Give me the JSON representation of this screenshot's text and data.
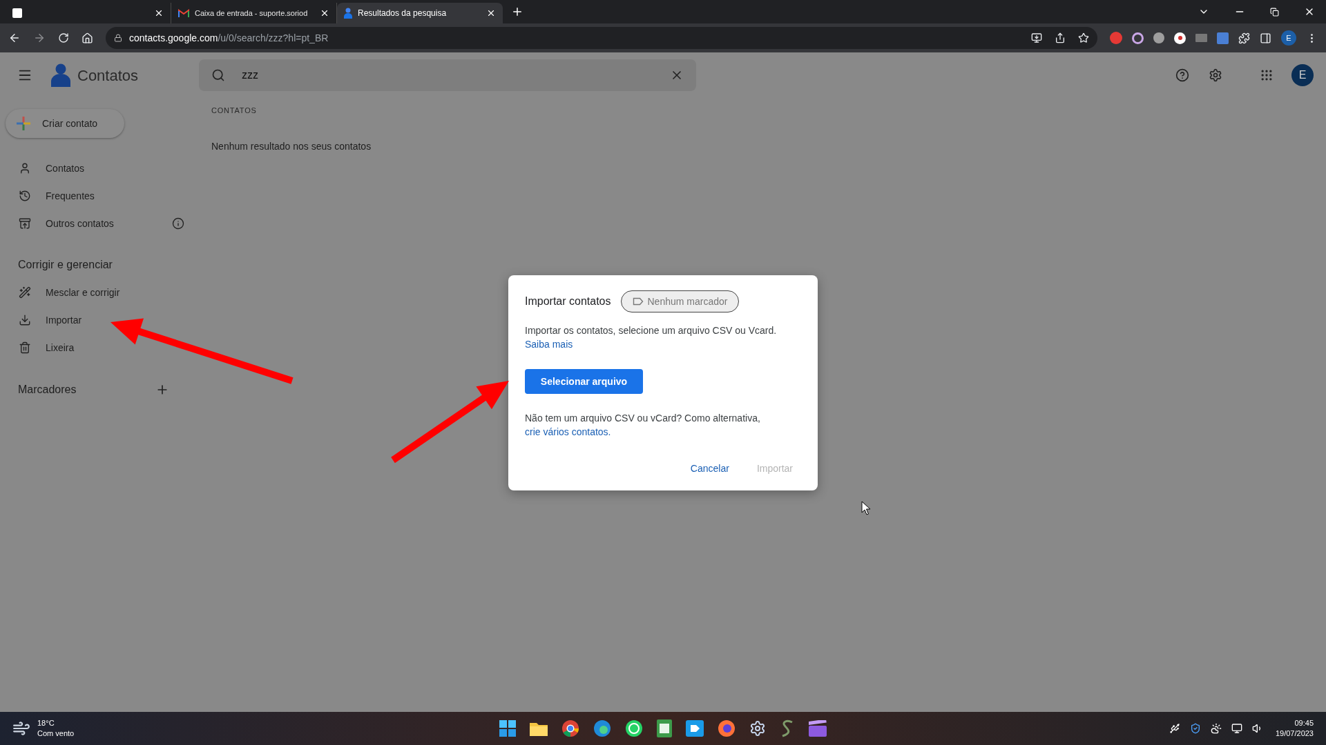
{
  "browser": {
    "tabs": [
      {
        "selected": false
      },
      {
        "title": "Caixa de entrada - suporte.soriod",
        "selected": false
      },
      {
        "title": "Resultados da pesquisa",
        "selected": true
      }
    ],
    "address": {
      "domain": "contacts.google.com",
      "path": "/u/0/search/zzz?hl=pt_BR"
    },
    "profile": "E"
  },
  "app": {
    "title": "Contatos",
    "search": {
      "value": "zzz"
    },
    "avatar": "E",
    "create_button": "Criar contato",
    "nav": [
      {
        "label": "Contatos"
      },
      {
        "label": "Frequentes"
      },
      {
        "label": "Outros contatos",
        "info": true
      }
    ],
    "manage_heading": "Corrigir e gerenciar",
    "manage": [
      {
        "label": "Mesclar e corrigir"
      },
      {
        "label": "Importar"
      },
      {
        "label": "Lixeira"
      }
    ],
    "labels_heading": "Marcadores",
    "results": {
      "heading": "CONTATOS",
      "message": "Nenhum resultado nos seus contatos"
    }
  },
  "dialog": {
    "title": "Importar contatos",
    "chip": "Nenhum marcador",
    "text": "Importar os contatos, selecione um arquivo CSV ou Vcard.",
    "link": "Saiba mais",
    "button": "Selecionar arquivo",
    "alt_text": "Não tem um arquivo CSV ou vCard? Como alternativa,",
    "alt_link": "crie vários contatos.",
    "actions": [
      {
        "label": "Cancelar",
        "disabled": false
      },
      {
        "label": "Importar",
        "disabled": true
      }
    ]
  },
  "taskbar": {
    "temperature": "18°C",
    "weather": "Com vento",
    "time": "09:45",
    "date": "19/07/2023"
  }
}
